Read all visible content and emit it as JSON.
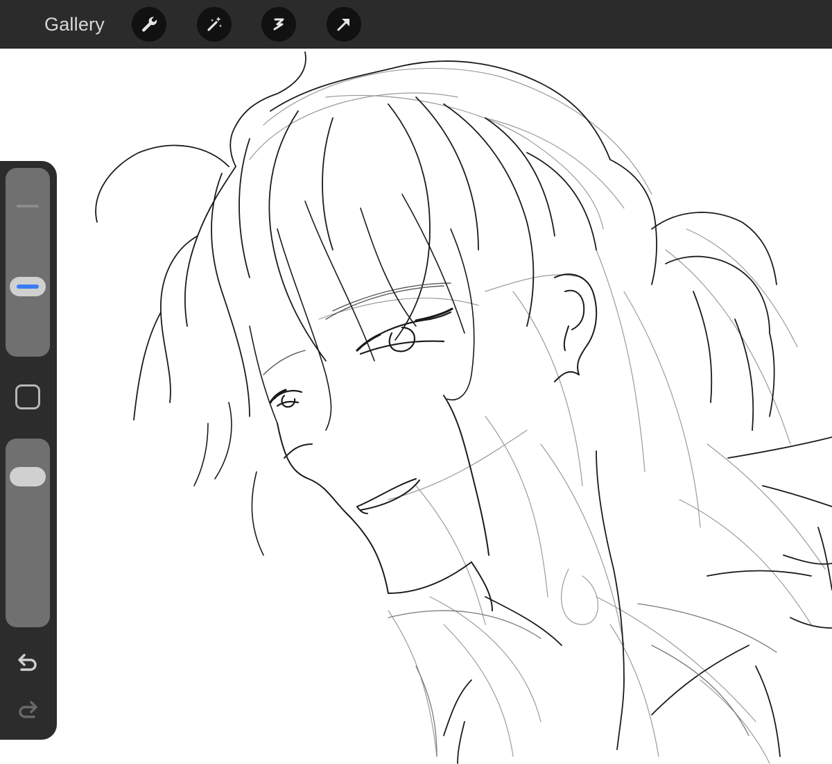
{
  "toolbar": {
    "gallery_label": "Gallery",
    "tools": [
      {
        "name": "actions",
        "icon": "wrench-icon"
      },
      {
        "name": "adjustments",
        "icon": "magic-wand-icon"
      },
      {
        "name": "selection",
        "icon": "selection-s-icon"
      },
      {
        "name": "transform",
        "icon": "arrow-cursor-icon"
      }
    ]
  },
  "sidebar": {
    "brush_size_level": 0.35,
    "brush_opacity_level": 0.85,
    "active_color": "#3a7bf3",
    "modify_icon": "square-outline-icon",
    "undo_icon": "undo-arrow-icon",
    "redo_icon": "redo-arrow-icon"
  },
  "canvas": {
    "background": "#ffffff",
    "content": "line-art-sketch"
  }
}
